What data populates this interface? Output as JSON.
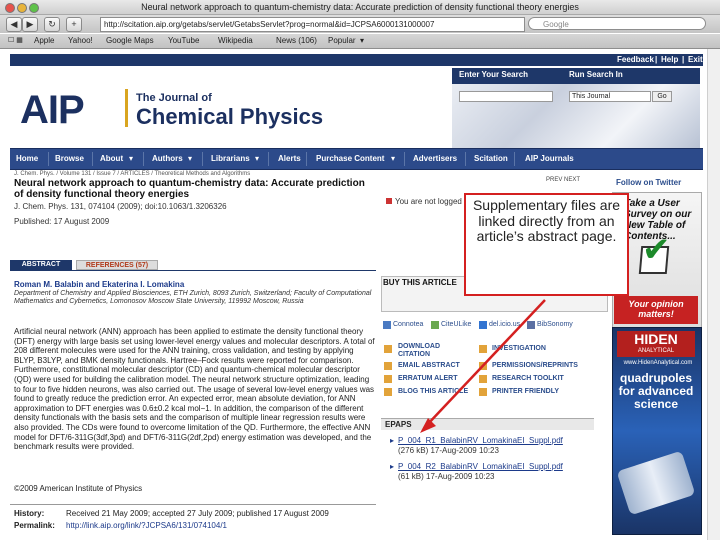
{
  "browser": {
    "window_title": "Neural network approach to quantum-chemistry data: Accurate prediction of density functional theory energies",
    "url": "http://scitation.aip.org/getabs/servlet/GetabsServlet?prog=normal&id=JCPSA6000131000007",
    "search_placeholder": "Google",
    "bookmarks": [
      "Apple",
      "Yahoo!",
      "Google Maps",
      "YouTube",
      "Wikipedia",
      "News (106)",
      "Popular"
    ]
  },
  "topbar": {
    "feedback": "Feedback",
    "help": "Help",
    "exit": "Exit"
  },
  "logo": {
    "aip": "AIP",
    "journal_line1": "The Journal of",
    "journal_line2": "Chemical Physics"
  },
  "search": {
    "enter_label": "Enter Your Search",
    "run_label": "Run Search In",
    "scope": "This Journal",
    "go": "Go"
  },
  "nav": [
    "Home",
    "Browse",
    "About",
    "Authors",
    "Librarians",
    "Alerts",
    "Purchase Content",
    "Advertisers",
    "Scitation",
    "AIP Journals"
  ],
  "article": {
    "breadcrumb": "J. Chem. Phys. / Volume 131 / Issue 7 / ARTICLES / Theoretical Methods and Algorithms",
    "title": "Neural network approach to quantum-chemistry data: Accurate prediction of density functional theory energies",
    "citation": "J. Chem. Phys. 131, 074104 (2009); doi:10.1063/1.3206326",
    "published": "Published: 17 August 2009",
    "not_logged": "You are not logged in",
    "prev_next": "PREV  NEXT",
    "tab_abstract": "ABSTRACT",
    "tab_references": "REFERENCES (57)",
    "authors": "Roman M. Balabin and Ekaterina I. Lomakina",
    "affiliations": "Department of Chemistry and Applied Biosciences, ETH Zurich, 8093 Zurich, Switzerland; Faculty of Computational Mathematics and Cybernetics, Lomonosov Moscow State University, 119992 Moscow, Russia",
    "abstract": "Artificial neural network (ANN) approach has been applied to estimate the density functional theory (DFT) energy with large basis set using lower-level energy values and molecular descriptors. A total of 208 different molecules were used for the ANN training, cross validation, and testing by applying BLYP, B3LYP, and BMK density functionals. Hartree–Fock results were reported for comparison. Furthermore, constitutional molecular descriptor (CD) and quantum-chemical molecular descriptor (QD) were used for building the calibration model. The neural network structure optimization, leading to four to five hidden neurons, was also carried out. The usage of several low-level energy values was found to greatly reduce the prediction error. An expected error, mean absolute deviation, for ANN approximation to DFT energies was 0.6±0.2 kcal mol−1. In addition, the comparison of the different density functionals with the basis sets and the comparison of multiple linear regression results were also provided. The CDs were found to overcome limitation of the QD. Furthermore, the effective ANN model for DFT/6-311G(3df,3pd) and DFT/6-311G(2df,2pd) energy estimation was developed, and the benchmark results were provided.",
    "copyright": "©2009 American Institute of Physics",
    "history_label": "History:",
    "history_value": "Received 21 May 2009; accepted 27 July 2009; published 17 August 2009",
    "permalink_label": "Permalink:",
    "permalink_value": "http://link.aip.org/link/?JCPSA6/131/074104/1"
  },
  "sidebar": {
    "buy_heading": "BUY THIS ARTICLE",
    "share": [
      "Connotea",
      "CiteULike",
      "del.icio.us",
      "BibSonomy"
    ],
    "tools_left": [
      "DOWNLOAD CITATION",
      "EMAIL ABSTRACT",
      "ERRATUM ALERT",
      "BLOG THIS ARTICLE"
    ],
    "tools_right": [
      "INVESTIGATION",
      "PERMISSIONS/REPRINTS",
      "RESEARCH TOOLKIT",
      "PRINTER FRIENDLY"
    ],
    "epaps_heading": "EPAPS",
    "epaps": [
      {
        "file": "P_004_R1_BalabinRV_LomakinaEI_Suppl.pdf",
        "meta": "(276 kB) 17-Aug-2009 10:23"
      },
      {
        "file": "P_004_R2_BalabinRV_LomakinaEI_Suppl.pdf",
        "meta": "(61 kB) 17-Aug-2009 10:23"
      }
    ],
    "twitter": "Follow on Twitter"
  },
  "ads": {
    "survey_text": "Take a User Survey on our New Table of Contents...",
    "opinion": "Your opinion matters!",
    "hiden_logo": "HIDEN",
    "hiden_sub": "ANALYTICAL",
    "hiden_url": "www.HidenAnalytical.com",
    "hiden_headline": "quadrupoles for advanced science"
  },
  "callout": {
    "text": "Supplementary files are linked directly from an article’s abstract page."
  },
  "colors": {
    "aip_navy": "#1e3769",
    "nav_blue": "#2c4a8a",
    "callout_red": "#d42020",
    "link_blue": "#1c3a8a"
  }
}
